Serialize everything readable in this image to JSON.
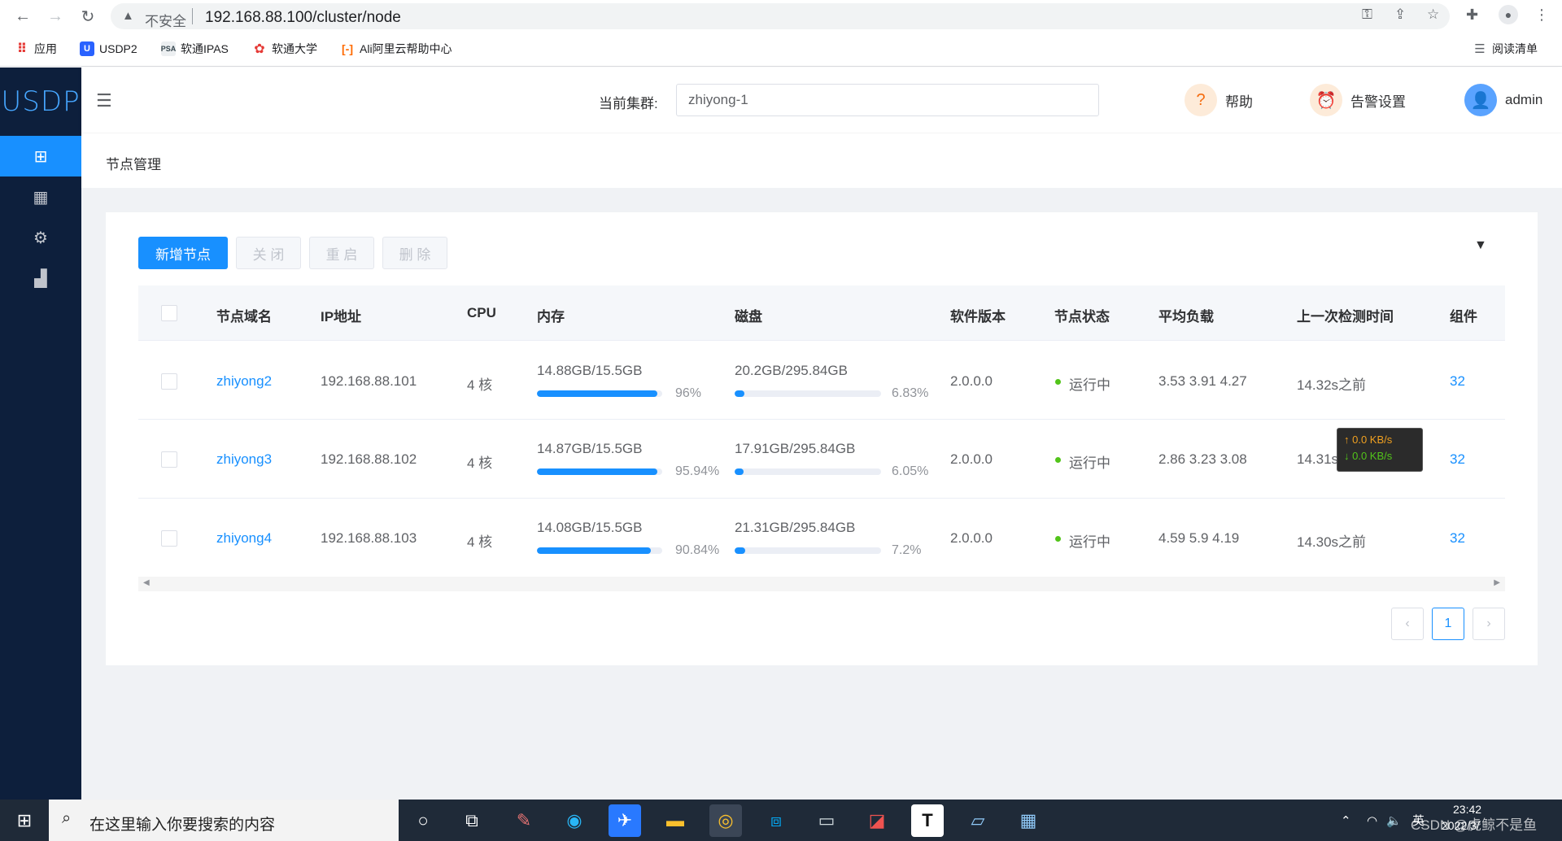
{
  "browser": {
    "insecure_label": "不安全",
    "url": "192.168.88.100/cluster/node",
    "bookmarks": [
      {
        "label": "应用"
      },
      {
        "label": "USDP2"
      },
      {
        "label": "软通IPAS"
      },
      {
        "label": "软通大学"
      },
      {
        "label": "Ali阿里云帮助中心"
      }
    ],
    "reading_list": "阅读清单"
  },
  "app": {
    "logo": "USDP",
    "cluster_label": "当前集群:",
    "cluster_value": "zhiyong-1",
    "help_label": "帮助",
    "alert_label": "告警设置",
    "user_label": "admin",
    "breadcrumb": "节点管理"
  },
  "toolbar": {
    "add_label": "新增节点",
    "close_label": "关 闭",
    "restart_label": "重 启",
    "delete_label": "删 除"
  },
  "table": {
    "headers": {
      "host": "节点域名",
      "ip": "IP地址",
      "cpu": "CPU",
      "mem": "内存",
      "disk": "磁盘",
      "version": "软件版本",
      "status": "节点状态",
      "load": "平均负载",
      "last_check": "上一次检测时间",
      "components": "组件"
    },
    "rows": [
      {
        "host": "zhiyong2",
        "ip": "192.168.88.101",
        "cpu": "4 核",
        "mem": "14.88GB/15.5GB",
        "mem_pct": "96%",
        "mem_frac": 0.96,
        "disk": "20.2GB/295.84GB",
        "disk_pct": "6.83%",
        "disk_frac": 0.0683,
        "version": "2.0.0.0",
        "status": "运行中",
        "load": "3.53 3.91 4.27",
        "last_check": "14.32s之前",
        "components": "32"
      },
      {
        "host": "zhiyong3",
        "ip": "192.168.88.102",
        "cpu": "4 核",
        "mem": "14.87GB/15.5GB",
        "mem_pct": "95.94%",
        "mem_frac": 0.9594,
        "disk": "17.91GB/295.84GB",
        "disk_pct": "6.05%",
        "disk_frac": 0.0605,
        "version": "2.0.0.0",
        "status": "运行中",
        "load": "2.86 3.23 3.08",
        "last_check": "14.31s",
        "components": "32"
      },
      {
        "host": "zhiyong4",
        "ip": "192.168.88.103",
        "cpu": "4 核",
        "mem": "14.08GB/15.5GB",
        "mem_pct": "90.84%",
        "mem_frac": 0.9084,
        "disk": "21.31GB/295.84GB",
        "disk_pct": "7.2%",
        "disk_frac": 0.072,
        "version": "2.0.0.0",
        "status": "运行中",
        "load": "4.59 5.9 4.19",
        "last_check": "14.30s之前",
        "components": "32"
      }
    ]
  },
  "pagination": {
    "current": "1"
  },
  "net_tooltip": {
    "up": "↑ 0.0 KB/s",
    "down": "↓ 0.0 KB/s"
  },
  "taskbar": {
    "search_placeholder": "在这里输入你要搜索的内容",
    "ime": "英",
    "time": "23:42",
    "date": "2022/3/",
    "watermark": "CSDN @虎鲸不是鱼"
  }
}
